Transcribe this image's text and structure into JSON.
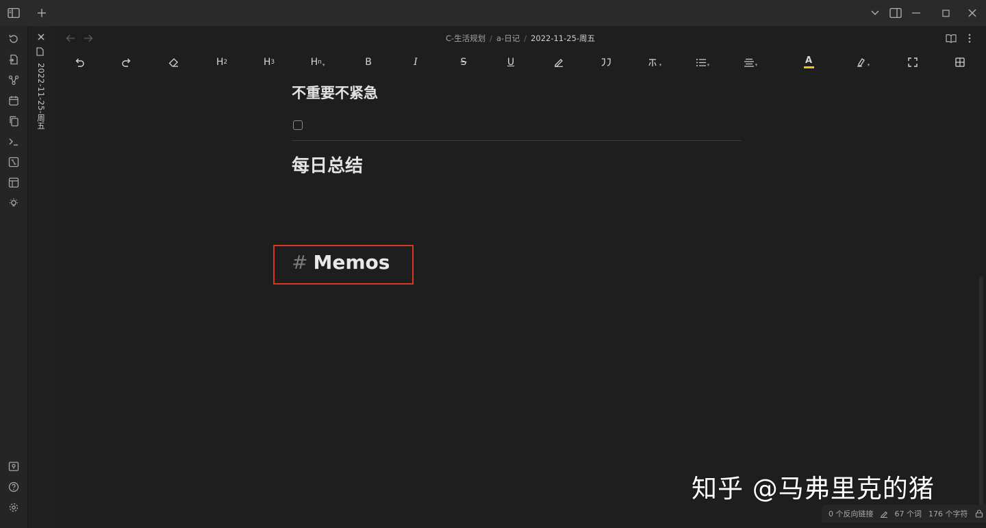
{
  "icons": {
    "sidebar_toggle": "sidebar-left-icon",
    "new_tab": "plus-icon",
    "tab_list": "chevron-down-icon",
    "right_sidebar": "sidebar-right-icon",
    "minimize": "minimize-icon",
    "maximize": "maximize-icon",
    "close": "close-icon"
  },
  "ribbon": {
    "top_items": [
      "sync-icon",
      "file-open-icon",
      "graph-icon",
      "calendar-icon",
      "copy-icon",
      "terminal-icon",
      "canvas-icon",
      "template-icon",
      "lightbulb-icon"
    ],
    "bottom_items": [
      "vault-icon",
      "help-icon",
      "settings-icon"
    ]
  },
  "tab": {
    "title": "2022-11-25-周五"
  },
  "view_header": {
    "breadcrumbs": [
      "C-生活规划",
      "a-日记",
      "2022-11-25-周五"
    ],
    "separator": "/"
  },
  "toolbar": {
    "h2": "H",
    "h2_sub": "2",
    "h3": "H",
    "h3_sub": "3",
    "hn": "H",
    "hn_sub": "n",
    "bold": "B",
    "italic": "I",
    "strike": "S",
    "underline": "U",
    "font_color_letter": "A",
    "font_color_accent": "#f0c419"
  },
  "document": {
    "heading_1": "不重要不紧急",
    "heading_2": "每日总结",
    "memos_hash": "#",
    "memos_title": "Memos"
  },
  "status": {
    "backlinks": "0 个反向链接",
    "words": "67 个词",
    "chars": "176 个字符"
  },
  "watermark": "知乎 @马弗里克的猪",
  "colors": {
    "highlight_border": "#d8381f",
    "background": "#1e1e1e"
  }
}
